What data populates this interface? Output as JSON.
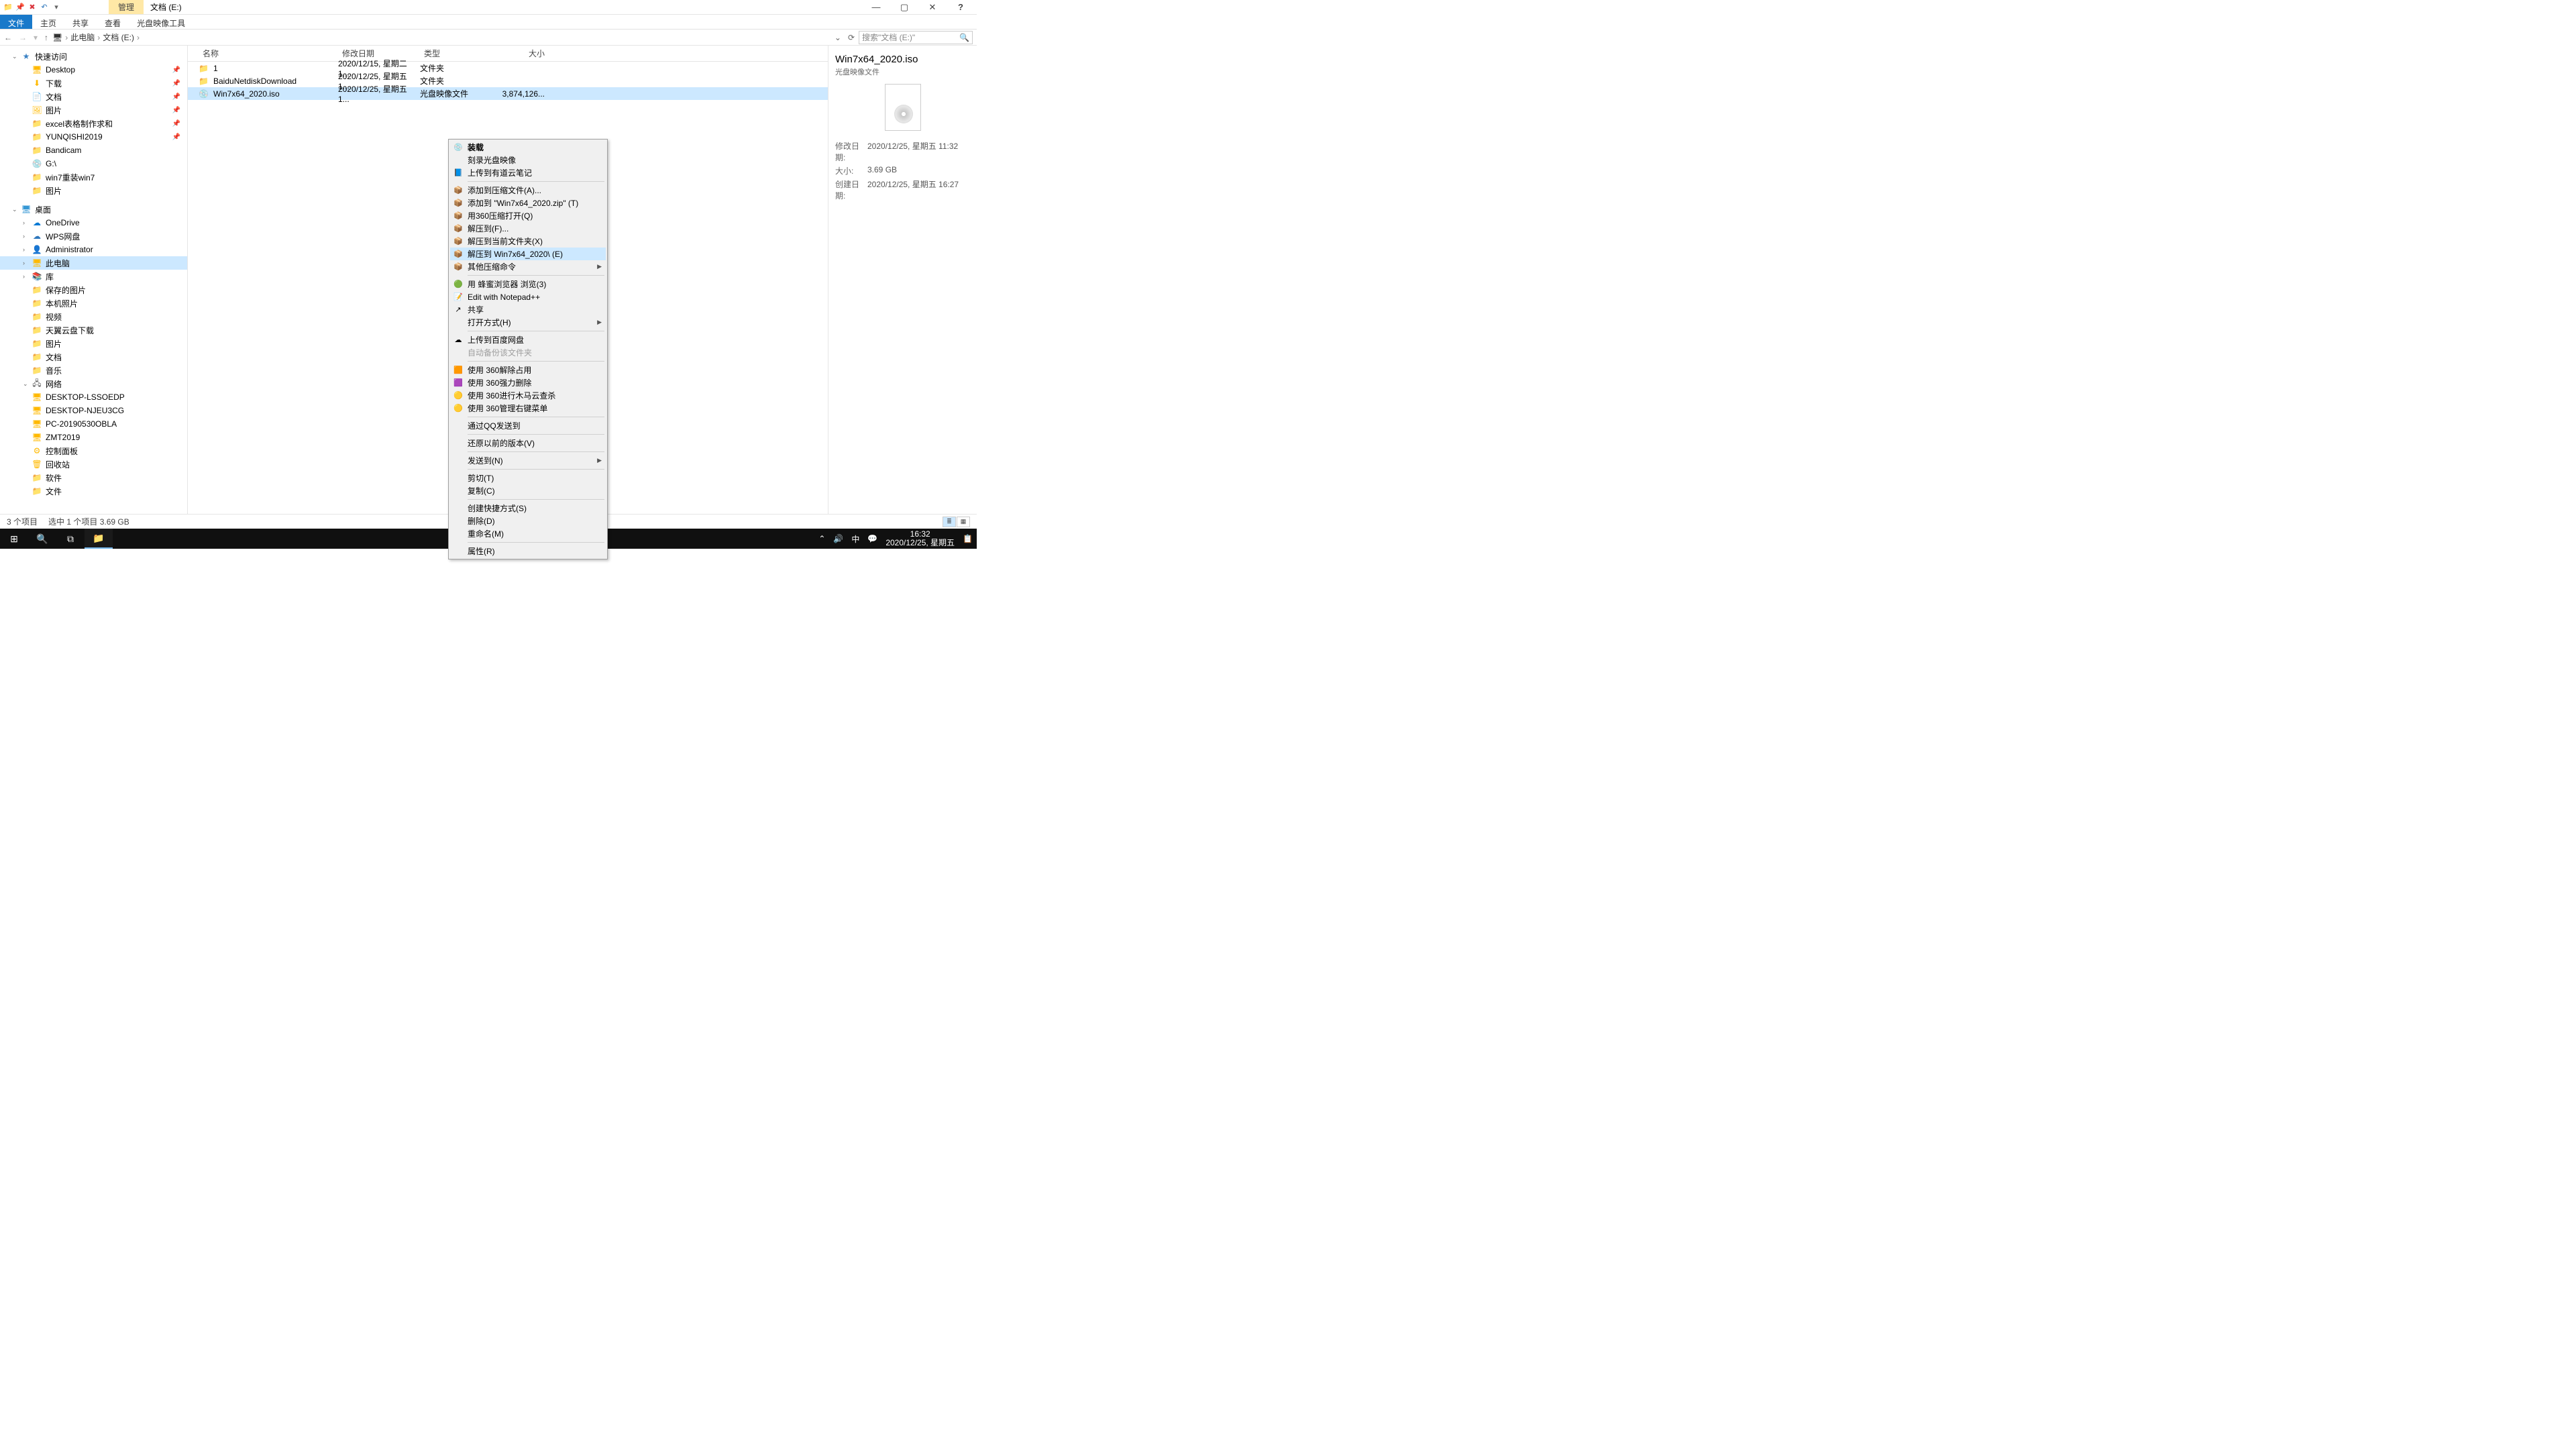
{
  "window": {
    "ctx_tab": "管理",
    "title": "文档 (E:)"
  },
  "ribbon": {
    "tabs": [
      "文件",
      "主页",
      "共享",
      "查看",
      "光盘映像工具"
    ]
  },
  "address": {
    "crumbs": [
      "此电脑",
      "文档 (E:)"
    ],
    "search_placeholder": "搜索\"文档 (E:)\""
  },
  "tree": {
    "quick_access": "快速访问",
    "items_qa": [
      {
        "label": "Desktop",
        "ico": "🖥",
        "pin": true
      },
      {
        "label": "下载",
        "ico": "⬇",
        "pin": true
      },
      {
        "label": "文档",
        "ico": "📄",
        "pin": true
      },
      {
        "label": "图片",
        "ico": "🖼",
        "pin": true
      },
      {
        "label": "excel表格制作求和",
        "ico": "📁",
        "pin": true
      },
      {
        "label": "YUNQISHI2019",
        "ico": "📁",
        "pin": true
      },
      {
        "label": "Bandicam",
        "ico": "📁"
      },
      {
        "label": "G:\\",
        "ico": "💿"
      },
      {
        "label": "win7重装win7",
        "ico": "📁"
      },
      {
        "label": "图片",
        "ico": "📁"
      }
    ],
    "desktop": "桌面",
    "items_desk": [
      {
        "label": "OneDrive",
        "ico": "☁",
        "cls": "ico-onedrive"
      },
      {
        "label": "WPS网盘",
        "ico": "☁",
        "cls": "ico-wps"
      },
      {
        "label": "Administrator",
        "ico": "👤"
      },
      {
        "label": "此电脑",
        "ico": "🖥",
        "sel": true
      },
      {
        "label": "库",
        "ico": "📚",
        "cls": "ico-lib"
      }
    ],
    "items_lib": [
      {
        "label": "保存的图片",
        "ico": "📁"
      },
      {
        "label": "本机照片",
        "ico": "📁"
      },
      {
        "label": "视频",
        "ico": "📁"
      },
      {
        "label": "天翼云盘下载",
        "ico": "📁"
      },
      {
        "label": "图片",
        "ico": "📁"
      },
      {
        "label": "文档",
        "ico": "📁"
      },
      {
        "label": "音乐",
        "ico": "📁"
      }
    ],
    "network": "网络",
    "items_net": [
      {
        "label": "DESKTOP-LSSOEDP",
        "ico": "🖥"
      },
      {
        "label": "DESKTOP-NJEU3CG",
        "ico": "🖥"
      },
      {
        "label": "PC-20190530OBLA",
        "ico": "🖥"
      },
      {
        "label": "ZMT2019",
        "ico": "🖥"
      }
    ],
    "items_bottom": [
      {
        "label": "控制面板",
        "ico": "⚙"
      },
      {
        "label": "回收站",
        "ico": "🗑"
      },
      {
        "label": "软件",
        "ico": "📁"
      },
      {
        "label": "文件",
        "ico": "📁"
      }
    ]
  },
  "columns": {
    "name": "名称",
    "date": "修改日期",
    "type": "类型",
    "size": "大小"
  },
  "rows": [
    {
      "ico": "📁",
      "name": "1",
      "date": "2020/12/15, 星期二 1...",
      "type": "文件夹",
      "size": ""
    },
    {
      "ico": "📁",
      "name": "BaiduNetdiskDownload",
      "date": "2020/12/25, 星期五 1...",
      "type": "文件夹",
      "size": ""
    },
    {
      "ico": "💿",
      "name": "Win7x64_2020.iso",
      "date": "2020/12/25, 星期五 1...",
      "type": "光盘映像文件",
      "size": "3,874,126...",
      "sel": true
    }
  ],
  "context_menu": [
    {
      "label": "装载",
      "ico": "💿",
      "bold": true
    },
    {
      "label": "刻录光盘映像"
    },
    {
      "label": "上传到有道云笔记",
      "ico": "📘"
    },
    {
      "sep": true
    },
    {
      "label": "添加到压缩文件(A)...",
      "ico": "📦"
    },
    {
      "label": "添加到 \"Win7x64_2020.zip\" (T)",
      "ico": "📦"
    },
    {
      "label": "用360压缩打开(Q)",
      "ico": "📦"
    },
    {
      "label": "解压到(F)...",
      "ico": "📦"
    },
    {
      "label": "解压到当前文件夹(X)",
      "ico": "📦"
    },
    {
      "label": "解压到 Win7x64_2020\\ (E)",
      "ico": "📦",
      "hl": true
    },
    {
      "label": "其他压缩命令",
      "ico": "📦",
      "sub": true
    },
    {
      "sep": true
    },
    {
      "label": "用 蜂蜜浏览器 浏览(3)",
      "ico": "🟢"
    },
    {
      "label": "Edit with Notepad++",
      "ico": "📝"
    },
    {
      "label": "共享",
      "ico": "↗"
    },
    {
      "label": "打开方式(H)",
      "sub": true
    },
    {
      "sep": true
    },
    {
      "label": "上传到百度网盘",
      "ico": "☁"
    },
    {
      "label": "自动备份该文件夹",
      "dis": true
    },
    {
      "sep": true
    },
    {
      "label": "使用 360解除占用",
      "ico": "🟧"
    },
    {
      "label": "使用 360强力删除",
      "ico": "🟪"
    },
    {
      "label": "使用 360进行木马云查杀",
      "ico": "🟡"
    },
    {
      "label": "使用 360管理右键菜单",
      "ico": "🟡"
    },
    {
      "sep": true
    },
    {
      "label": "通过QQ发送到"
    },
    {
      "sep": true
    },
    {
      "label": "还原以前的版本(V)"
    },
    {
      "sep": true
    },
    {
      "label": "发送到(N)",
      "sub": true
    },
    {
      "sep": true
    },
    {
      "label": "剪切(T)"
    },
    {
      "label": "复制(C)"
    },
    {
      "sep": true
    },
    {
      "label": "创建快捷方式(S)"
    },
    {
      "label": "删除(D)"
    },
    {
      "label": "重命名(M)"
    },
    {
      "sep": true
    },
    {
      "label": "属性(R)"
    }
  ],
  "details": {
    "title": "Win7x64_2020.iso",
    "subtitle": "光盘映像文件",
    "props": [
      {
        "k": "修改日期:",
        "v": "2020/12/25, 星期五 11:32"
      },
      {
        "k": "大小:",
        "v": "3.69 GB"
      },
      {
        "k": "创建日期:",
        "v": "2020/12/25, 星期五 16:27"
      }
    ]
  },
  "status": {
    "count": "3 个项目",
    "sel": "选中 1 个项目  3.69 GB"
  },
  "taskbar": {
    "time": "16:32",
    "date": "2020/12/25, 星期五",
    "ime": "中"
  }
}
